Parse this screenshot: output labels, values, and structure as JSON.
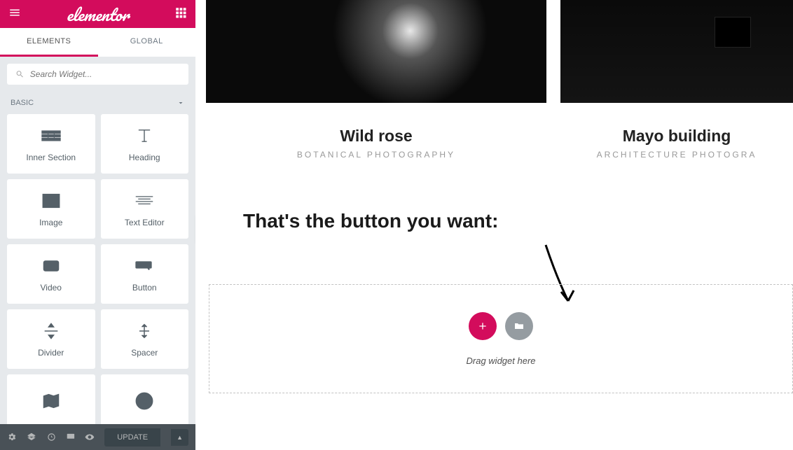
{
  "brand": "elementor",
  "tabs": {
    "elements": "ELEMENTS",
    "global": "GLOBAL"
  },
  "search": {
    "placeholder": "Search Widget..."
  },
  "category": "BASIC",
  "widgets": [
    {
      "label": "Inner Section"
    },
    {
      "label": "Heading"
    },
    {
      "label": "Image"
    },
    {
      "label": "Text Editor"
    },
    {
      "label": "Video"
    },
    {
      "label": "Button"
    },
    {
      "label": "Divider"
    },
    {
      "label": "Spacer"
    },
    {
      "label": ""
    },
    {
      "label": ""
    }
  ],
  "footer": {
    "update": "UPDATE"
  },
  "gallery": [
    {
      "title": "Wild rose",
      "sub": "BOTANICAL PHOTOGRAPHY"
    },
    {
      "title": "Mayo building",
      "sub": "ARCHITECTURE PHOTOGRA"
    }
  ],
  "annotation": "That's the button you want:",
  "dropzone": {
    "text": "Drag widget here"
  }
}
